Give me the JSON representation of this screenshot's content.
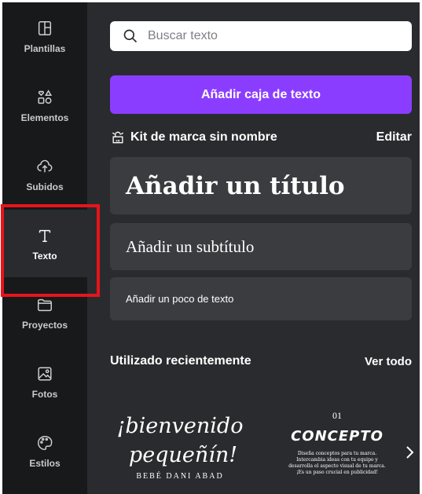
{
  "sidebar": {
    "items": [
      {
        "label": "Plantillas",
        "icon": "templates-icon"
      },
      {
        "label": "Elementos",
        "icon": "elements-icon"
      },
      {
        "label": "Subidos",
        "icon": "upload-icon"
      },
      {
        "label": "Texto",
        "icon": "text-icon",
        "active": true
      },
      {
        "label": "Proyectos",
        "icon": "folder-icon"
      },
      {
        "label": "Fotos",
        "icon": "photo-icon"
      },
      {
        "label": "Estilos",
        "icon": "palette-icon"
      }
    ]
  },
  "search": {
    "placeholder": "Buscar texto"
  },
  "add_text_button": {
    "label": "Añadir caja de texto"
  },
  "brand_kit": {
    "name": "Kit de marca sin nombre",
    "edit_label": "Editar"
  },
  "text_options": {
    "title": "Añadir un título",
    "subtitle": "Añadir un subtítulo",
    "body": "Añadir un poco de texto"
  },
  "recent": {
    "heading": "Utilizado recientemente",
    "see_all": "Ver todo",
    "items": [
      {
        "line1": "¡bienvenido",
        "line2": "pequeñín!",
        "line3": "BEBÉ DANI ABAD"
      },
      {
        "number": "01",
        "title": "CONCEPTO",
        "desc_lines": [
          "Diseña conceptos para tu marca.",
          "Intercambia ideas con tu equipo y",
          "desarrolla el aspecto visual de tu marca.",
          "¡Es un paso crucial en publicidad!"
        ]
      }
    ]
  },
  "colors": {
    "accent": "#8b3dff",
    "sidebar_bg": "#18191b",
    "panel_bg": "#2a2b2e",
    "card_bg": "#3b3c40",
    "highlight": "#e8141b"
  }
}
